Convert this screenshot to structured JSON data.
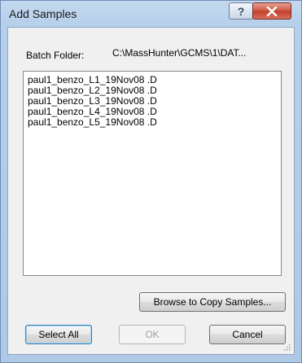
{
  "window": {
    "title": "Add Samples",
    "help_glyph": "?",
    "close_glyph": "✕"
  },
  "batch_folder": {
    "label": "Batch Folder:",
    "path": "C:\\MassHunter\\GCMS\\1\\DAT..."
  },
  "samples": [
    "paul1_benzo_L1_19Nov08 .D",
    "paul1_benzo_L2_19Nov08 .D",
    "paul1_benzo_L3_19Nov08 .D",
    "paul1_benzo_L4_19Nov08 .D",
    "paul1_benzo_L5_19Nov08 .D"
  ],
  "buttons": {
    "browse": "Browse to Copy Samples...",
    "select_all": "Select All",
    "ok": "OK",
    "cancel": "Cancel"
  },
  "icons": {
    "help": "help-icon",
    "close": "close-icon",
    "resize": "resize-grip-icon"
  }
}
